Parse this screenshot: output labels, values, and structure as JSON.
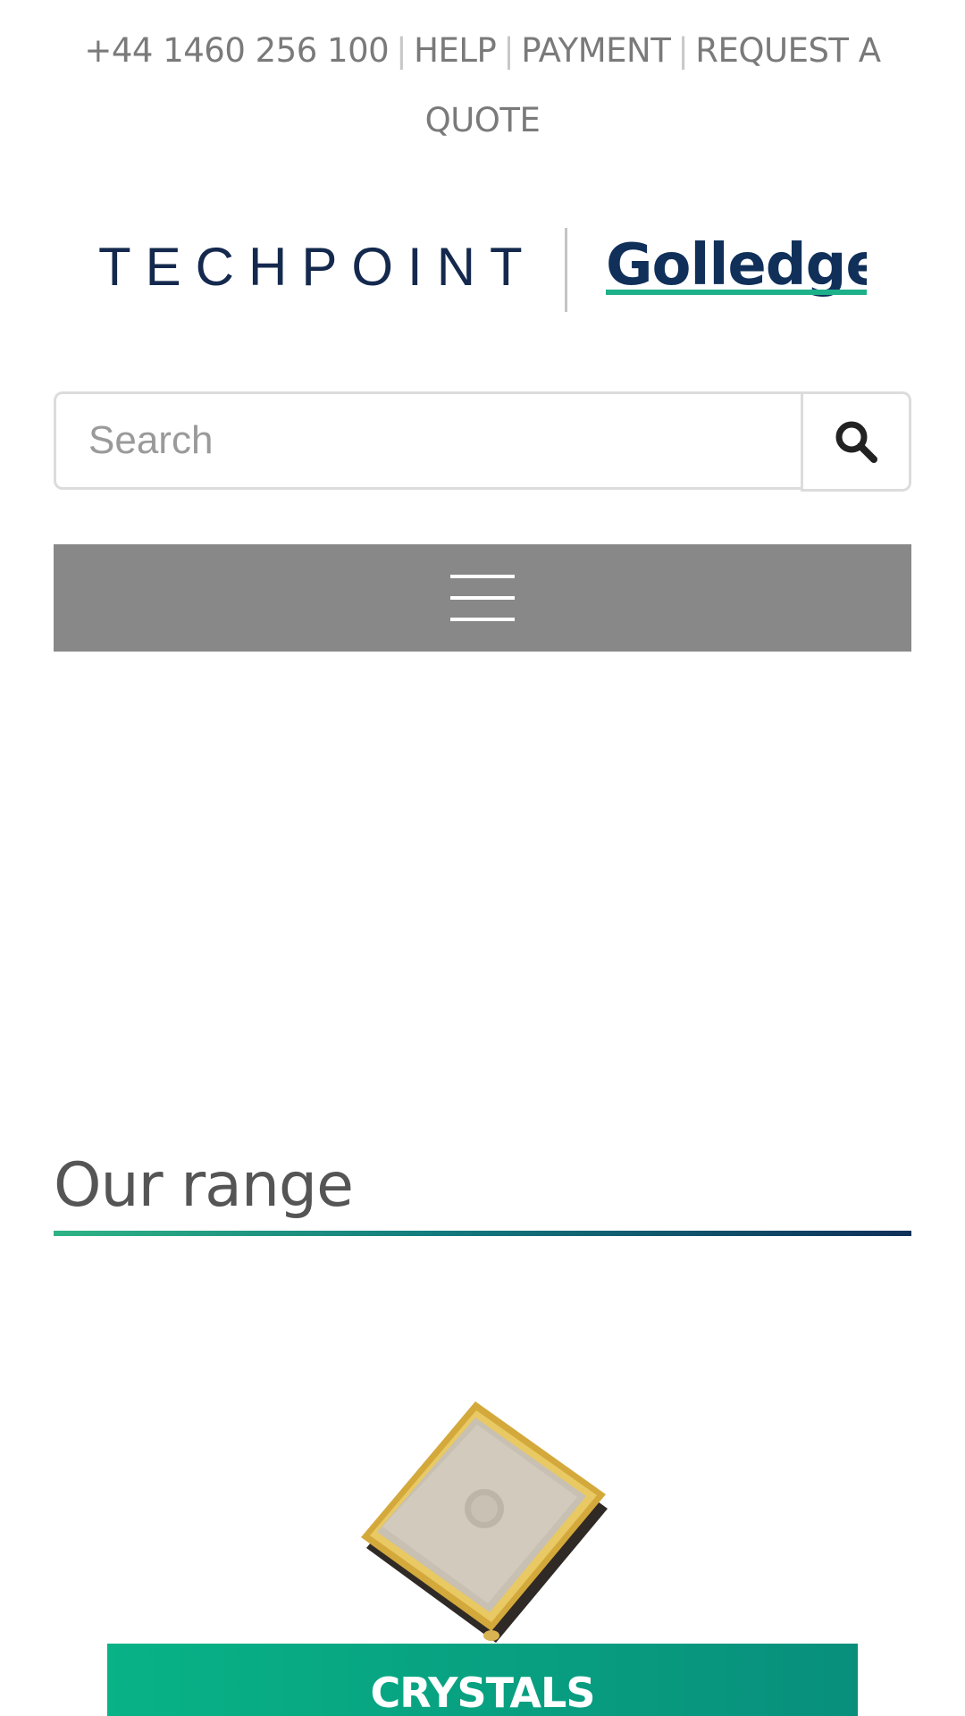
{
  "top_links": {
    "phone": "+44 1460 256 100",
    "separator": "|",
    "help": "HELP",
    "payment": "PAYMENT",
    "request_quote": "REQUEST A QUOTE"
  },
  "logo": {
    "left_brand": "TECHPOINT",
    "right_brand": "Golledge"
  },
  "search": {
    "placeholder": "Search",
    "value": "",
    "button_icon": "search-icon"
  },
  "menu": {
    "icon": "hamburger-icon"
  },
  "section": {
    "title": "Our range"
  },
  "products": [
    {
      "category": "CRYSTALS",
      "image": "smd-crystal-component"
    }
  ],
  "colors": {
    "menu_bar": "#888888",
    "accent_green": "#08b386",
    "brand_navy": "#10305a",
    "text_grey": "#7a7a7a"
  }
}
